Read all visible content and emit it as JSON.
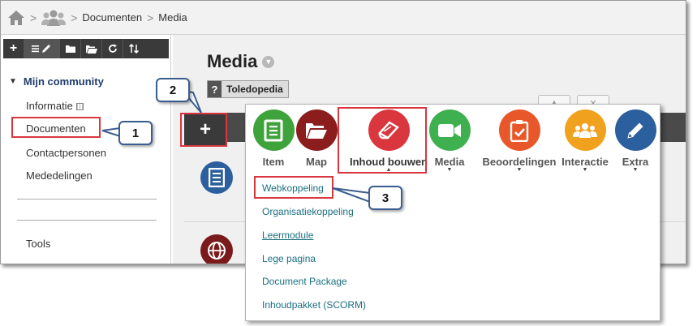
{
  "breadcrumb": {
    "items": [
      "Documenten",
      "Media"
    ],
    "separator": ">"
  },
  "sidebar": {
    "section_title": "Mijn community",
    "items": [
      "Informatie",
      "Documenten",
      "Contactpersonen",
      "Mededelingen"
    ],
    "footer_item": "Tools"
  },
  "content": {
    "title": "Media",
    "badge_icon": "?",
    "badge_label": "Toledopedia",
    "add_symbol": "+"
  },
  "menu": {
    "tools": [
      {
        "label": "Item",
        "icon": "document-icon",
        "color": "#3fa33b"
      },
      {
        "label": "Map",
        "icon": "folder-icon",
        "color": "#8b1d1d"
      },
      {
        "label": "Inhoud bouwen",
        "icon": "book-icon",
        "color": "#d9363e"
      },
      {
        "label": "Media",
        "icon": "video-camera-icon",
        "color": "#3fb04f"
      },
      {
        "label": "Beoordelingen",
        "icon": "clipboard-icon",
        "color": "#e8572a"
      },
      {
        "label": "Interactie",
        "icon": "group-icon",
        "color": "#f0a21f"
      },
      {
        "label": "Extra",
        "icon": "pencil-icon",
        "color": "#2c5f9e"
      }
    ],
    "items": [
      "Webkoppeling",
      "Organisatiekoppeling",
      "Leermodule",
      "Lege pagina",
      "Document Package",
      "Inhoudpakket (SCORM)"
    ]
  },
  "callouts": {
    "one": "1",
    "two": "2",
    "three": "3"
  },
  "colors": {
    "highlight": "#d9363e",
    "callout_border": "#3a5d8f",
    "link": "#1a6f80",
    "sidebar_title": "#1f3c6b"
  }
}
